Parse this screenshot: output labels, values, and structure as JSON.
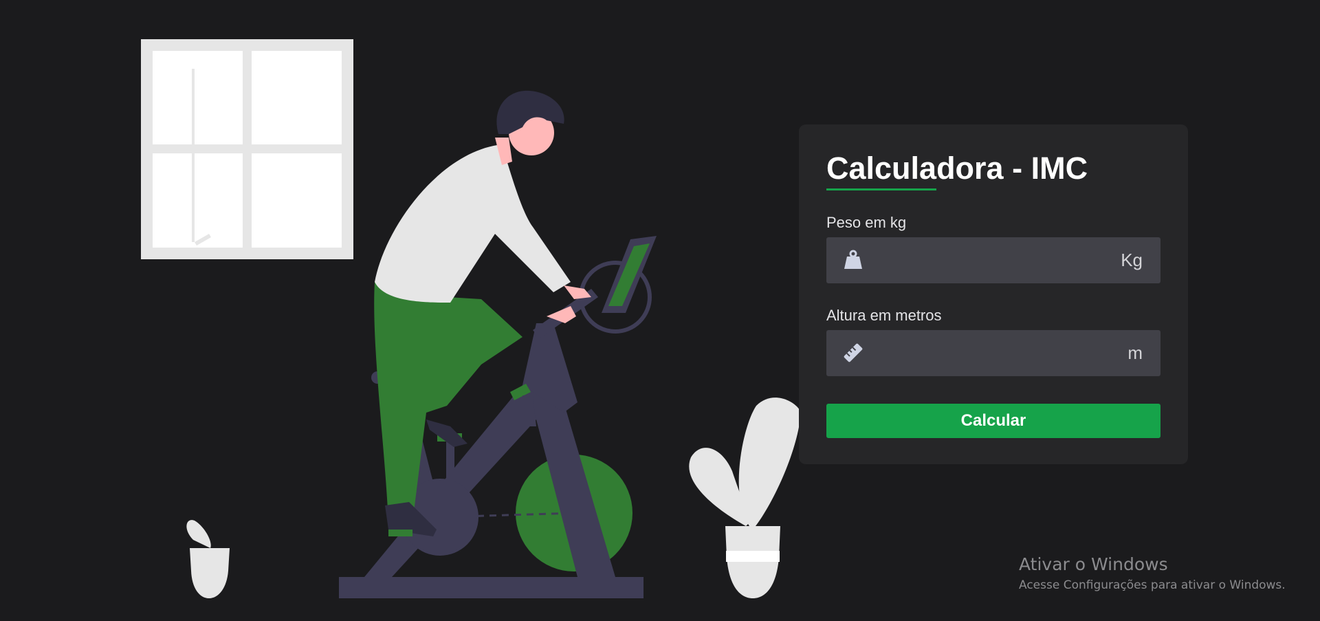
{
  "card": {
    "title": "Calculadora - IMC",
    "weight": {
      "label": "Peso em kg",
      "placeholder": "",
      "value": "",
      "unit": "Kg",
      "icon": "weight-icon"
    },
    "height": {
      "label": "Altura em metros",
      "placeholder": "",
      "value": "",
      "unit": "m",
      "icon": "ruler-icon"
    },
    "submit_label": "Calcular"
  },
  "colors": {
    "background": "#1b1b1d",
    "card": "#262628",
    "input": "#414148",
    "accent": "#16a34a",
    "illustration_green": "#327d33",
    "illustration_dark": "#3f3d56",
    "illustration_light": "#e6e6e6"
  },
  "windows_watermark": {
    "title": "Ativar o Windows",
    "subtitle": "Acesse Configurações para ativar o Windows."
  }
}
